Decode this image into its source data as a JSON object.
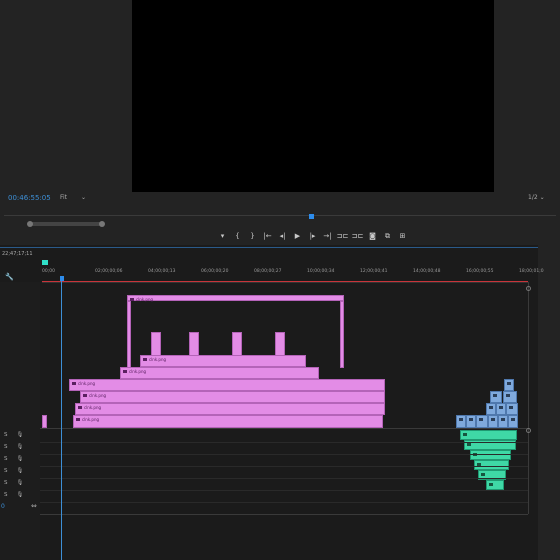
{
  "monitor": {
    "timecode": "00:46:55:05",
    "fit_label": "Fit",
    "fit_chevron": "⌄",
    "resolution": "1/2",
    "resolution_chevron": "⌄"
  },
  "transport": {
    "buttons": [
      {
        "icon": "marker-icon",
        "glyph": "▾"
      },
      {
        "icon": "mark-in-icon",
        "glyph": "{"
      },
      {
        "icon": "mark-out-icon",
        "glyph": "}"
      },
      {
        "icon": "go-to-in-icon",
        "glyph": "|←"
      },
      {
        "icon": "step-back-icon",
        "glyph": "◂|"
      },
      {
        "icon": "play-icon",
        "glyph": "▶"
      },
      {
        "icon": "step-forward-icon",
        "glyph": "|▸"
      },
      {
        "icon": "go-to-out-icon",
        "glyph": "→|"
      },
      {
        "icon": "insert-icon",
        "glyph": "⊐⊏"
      },
      {
        "icon": "overwrite-icon",
        "glyph": "⊐⊏"
      },
      {
        "icon": "export-frame-icon",
        "glyph": "◙"
      },
      {
        "icon": "comparison-view-icon",
        "glyph": "⧉"
      },
      {
        "icon": "button-editor-icon",
        "glyph": "⊞"
      }
    ]
  },
  "sequence": {
    "timecode": "22;47;17;11",
    "ruler_ticks": [
      "00;00",
      "02;00;00;06",
      "04;00;00;13",
      "06;00;00;20",
      "08;00;00;27",
      "10;00;00;34",
      "12;00;00;41",
      "14;00;00;48",
      "16;00;00;55",
      "18;00;01;0"
    ],
    "tools": {
      "wrench": "🔧"
    },
    "audio_tracks": [
      {
        "solo": "S",
        "mic": "🎙"
      },
      {
        "solo": "S",
        "mic": "🎙"
      },
      {
        "solo": "S",
        "mic": "🎙"
      },
      {
        "solo": "S",
        "mic": "🎙"
      },
      {
        "solo": "S",
        "mic": "🎙"
      },
      {
        "solo": "S",
        "mic": "🎙"
      }
    ],
    "footer_value": "0",
    "footer_icon": "⇔"
  },
  "clips": {
    "pink_label": "clnk.png",
    "colors": {
      "pink": "#e38ce6",
      "blue": "#7fa9dc",
      "green": "#3fd8a6"
    }
  }
}
